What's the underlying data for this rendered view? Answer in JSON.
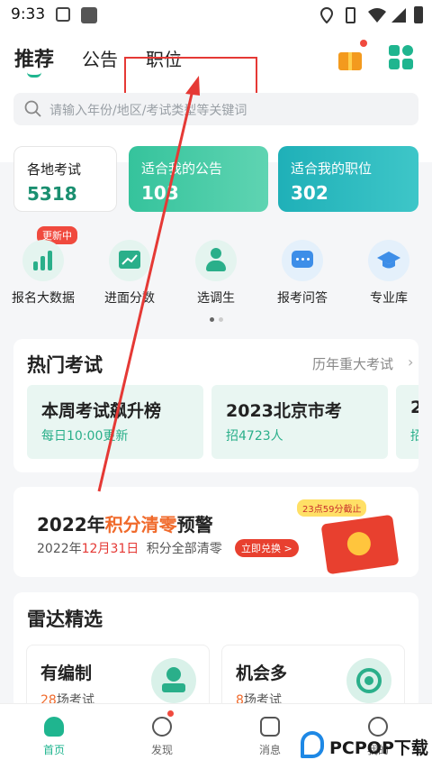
{
  "status": {
    "time": "9:33"
  },
  "tabs": [
    {
      "label": "推荐",
      "active": true
    },
    {
      "label": "公告",
      "active": false
    },
    {
      "label": "职位",
      "active": false
    }
  ],
  "search": {
    "placeholder": "请输入年份/地区/考试类型等关键词"
  },
  "stats": [
    {
      "title": "各地考试",
      "value": "5318"
    },
    {
      "title": "适合我的公告",
      "value": "103"
    },
    {
      "title": "适合我的职位",
      "value": "302"
    }
  ],
  "shortcuts": {
    "badge": "更新中",
    "items": [
      {
        "label": "报名大数据"
      },
      {
        "label": "进面分数"
      },
      {
        "label": "选调生"
      },
      {
        "label": "报考问答"
      },
      {
        "label": "专业库"
      }
    ]
  },
  "hot": {
    "title": "热门考试",
    "more": "历年重大考试",
    "cards": [
      {
        "title": "本周考试飙升榜",
        "sub": "每日10:00更新"
      },
      {
        "title": "2023北京市考",
        "sub": "招4723人"
      },
      {
        "title": "2",
        "sub": "招"
      }
    ]
  },
  "promo": {
    "title_a": "2022年",
    "title_b": "积分清零",
    "title_c": "预警",
    "sub_a": "2022年",
    "sub_b": "12月31日",
    "sub_c": "积分全部清零",
    "button": "立即兑换 >",
    "deadline": "23点59分截止"
  },
  "radar": {
    "title": "雷达精选",
    "cards": [
      {
        "title": "有编制",
        "count": "28",
        "unit": "场考试"
      },
      {
        "title": "机会多",
        "count": "8",
        "unit": "场考试"
      }
    ]
  },
  "nav": [
    {
      "label": "首页",
      "active": true
    },
    {
      "label": "发现",
      "active": false
    },
    {
      "label": "消息",
      "active": false
    },
    {
      "label": "我的",
      "active": false
    }
  ],
  "watermark": {
    "text": "PCPOP下载"
  },
  "colors": {
    "brand": "#1fb58f",
    "alert": "#e53935",
    "accent": "#f06a2b"
  }
}
